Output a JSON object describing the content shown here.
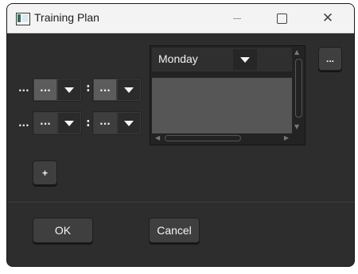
{
  "window": {
    "title": "Training Plan"
  },
  "titlebar": {
    "close_glyph": "✕"
  },
  "rows": [
    {
      "label": "...",
      "hour": "...",
      "separator": ":",
      "minute": "..."
    },
    {
      "label": "...",
      "hour": "...",
      "separator": ":",
      "minute": "..."
    }
  ],
  "day_selector": {
    "value": "Monday"
  },
  "buttons": {
    "browse_label": "...",
    "add_label": "+",
    "ok_label": "OK",
    "cancel_label": "Cancel"
  },
  "colors": {
    "background": "#2d2d2d",
    "titlebar": "#f3f3f3",
    "text": "#f5f5f5"
  }
}
